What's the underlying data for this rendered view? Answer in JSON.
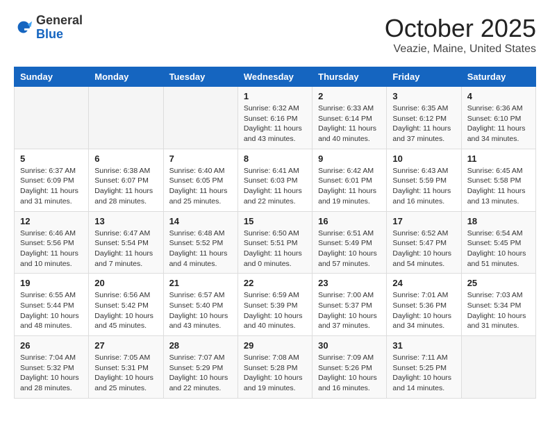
{
  "logo": {
    "general": "General",
    "blue": "Blue"
  },
  "header": {
    "month": "October 2025",
    "location": "Veazie, Maine, United States"
  },
  "weekdays": [
    "Sunday",
    "Monday",
    "Tuesday",
    "Wednesday",
    "Thursday",
    "Friday",
    "Saturday"
  ],
  "weeks": [
    [
      {
        "day": "",
        "info": ""
      },
      {
        "day": "",
        "info": ""
      },
      {
        "day": "",
        "info": ""
      },
      {
        "day": "1",
        "info": "Sunrise: 6:32 AM\nSunset: 6:16 PM\nDaylight: 11 hours\nand 43 minutes."
      },
      {
        "day": "2",
        "info": "Sunrise: 6:33 AM\nSunset: 6:14 PM\nDaylight: 11 hours\nand 40 minutes."
      },
      {
        "day": "3",
        "info": "Sunrise: 6:35 AM\nSunset: 6:12 PM\nDaylight: 11 hours\nand 37 minutes."
      },
      {
        "day": "4",
        "info": "Sunrise: 6:36 AM\nSunset: 6:10 PM\nDaylight: 11 hours\nand 34 minutes."
      }
    ],
    [
      {
        "day": "5",
        "info": "Sunrise: 6:37 AM\nSunset: 6:09 PM\nDaylight: 11 hours\nand 31 minutes."
      },
      {
        "day": "6",
        "info": "Sunrise: 6:38 AM\nSunset: 6:07 PM\nDaylight: 11 hours\nand 28 minutes."
      },
      {
        "day": "7",
        "info": "Sunrise: 6:40 AM\nSunset: 6:05 PM\nDaylight: 11 hours\nand 25 minutes."
      },
      {
        "day": "8",
        "info": "Sunrise: 6:41 AM\nSunset: 6:03 PM\nDaylight: 11 hours\nand 22 minutes."
      },
      {
        "day": "9",
        "info": "Sunrise: 6:42 AM\nSunset: 6:01 PM\nDaylight: 11 hours\nand 19 minutes."
      },
      {
        "day": "10",
        "info": "Sunrise: 6:43 AM\nSunset: 5:59 PM\nDaylight: 11 hours\nand 16 minutes."
      },
      {
        "day": "11",
        "info": "Sunrise: 6:45 AM\nSunset: 5:58 PM\nDaylight: 11 hours\nand 13 minutes."
      }
    ],
    [
      {
        "day": "12",
        "info": "Sunrise: 6:46 AM\nSunset: 5:56 PM\nDaylight: 11 hours\nand 10 minutes."
      },
      {
        "day": "13",
        "info": "Sunrise: 6:47 AM\nSunset: 5:54 PM\nDaylight: 11 hours\nand 7 minutes."
      },
      {
        "day": "14",
        "info": "Sunrise: 6:48 AM\nSunset: 5:52 PM\nDaylight: 11 hours\nand 4 minutes."
      },
      {
        "day": "15",
        "info": "Sunrise: 6:50 AM\nSunset: 5:51 PM\nDaylight: 11 hours\nand 0 minutes."
      },
      {
        "day": "16",
        "info": "Sunrise: 6:51 AM\nSunset: 5:49 PM\nDaylight: 10 hours\nand 57 minutes."
      },
      {
        "day": "17",
        "info": "Sunrise: 6:52 AM\nSunset: 5:47 PM\nDaylight: 10 hours\nand 54 minutes."
      },
      {
        "day": "18",
        "info": "Sunrise: 6:54 AM\nSunset: 5:45 PM\nDaylight: 10 hours\nand 51 minutes."
      }
    ],
    [
      {
        "day": "19",
        "info": "Sunrise: 6:55 AM\nSunset: 5:44 PM\nDaylight: 10 hours\nand 48 minutes."
      },
      {
        "day": "20",
        "info": "Sunrise: 6:56 AM\nSunset: 5:42 PM\nDaylight: 10 hours\nand 45 minutes."
      },
      {
        "day": "21",
        "info": "Sunrise: 6:57 AM\nSunset: 5:40 PM\nDaylight: 10 hours\nand 43 minutes."
      },
      {
        "day": "22",
        "info": "Sunrise: 6:59 AM\nSunset: 5:39 PM\nDaylight: 10 hours\nand 40 minutes."
      },
      {
        "day": "23",
        "info": "Sunrise: 7:00 AM\nSunset: 5:37 PM\nDaylight: 10 hours\nand 37 minutes."
      },
      {
        "day": "24",
        "info": "Sunrise: 7:01 AM\nSunset: 5:36 PM\nDaylight: 10 hours\nand 34 minutes."
      },
      {
        "day": "25",
        "info": "Sunrise: 7:03 AM\nSunset: 5:34 PM\nDaylight: 10 hours\nand 31 minutes."
      }
    ],
    [
      {
        "day": "26",
        "info": "Sunrise: 7:04 AM\nSunset: 5:32 PM\nDaylight: 10 hours\nand 28 minutes."
      },
      {
        "day": "27",
        "info": "Sunrise: 7:05 AM\nSunset: 5:31 PM\nDaylight: 10 hours\nand 25 minutes."
      },
      {
        "day": "28",
        "info": "Sunrise: 7:07 AM\nSunset: 5:29 PM\nDaylight: 10 hours\nand 22 minutes."
      },
      {
        "day": "29",
        "info": "Sunrise: 7:08 AM\nSunset: 5:28 PM\nDaylight: 10 hours\nand 19 minutes."
      },
      {
        "day": "30",
        "info": "Sunrise: 7:09 AM\nSunset: 5:26 PM\nDaylight: 10 hours\nand 16 minutes."
      },
      {
        "day": "31",
        "info": "Sunrise: 7:11 AM\nSunset: 5:25 PM\nDaylight: 10 hours\nand 14 minutes."
      },
      {
        "day": "",
        "info": ""
      }
    ]
  ]
}
